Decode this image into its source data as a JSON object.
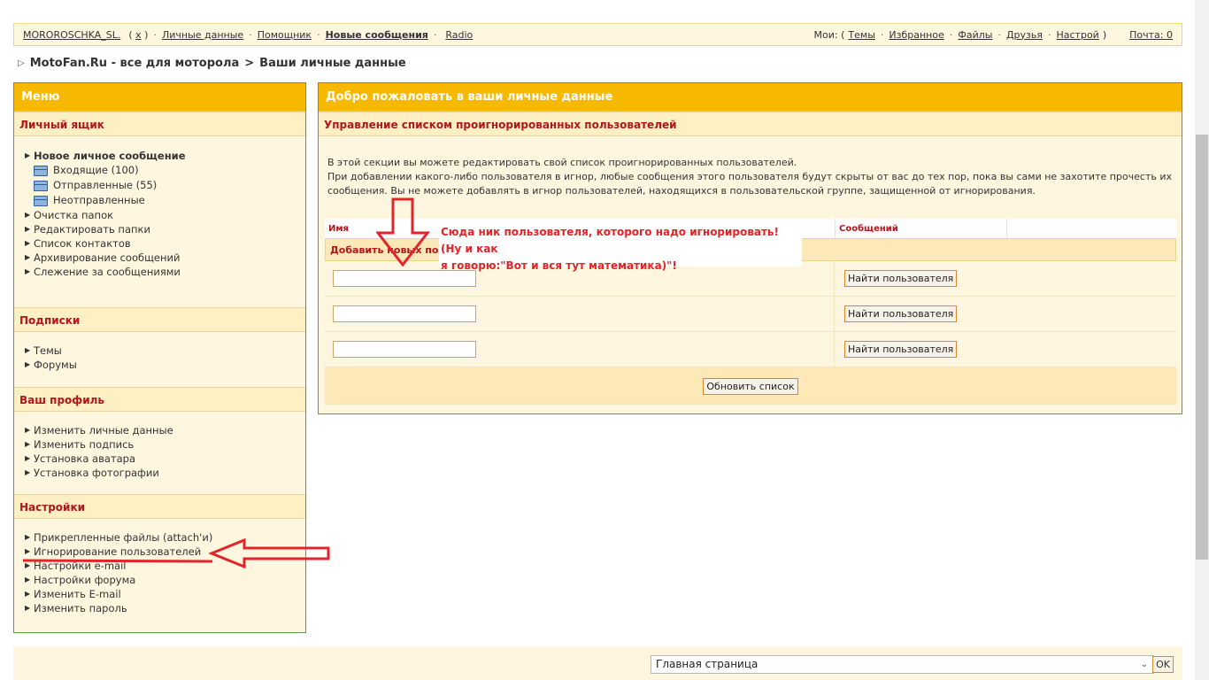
{
  "topbar": {
    "username": "MOROROSCHKA_SL.",
    "logout": "x",
    "personal": "Личные данные",
    "helper": "Помощник",
    "new_messages": "Новые сообщения",
    "radio": "Radio",
    "my_label": "Мои: (",
    "topics": "Темы",
    "favorites": "Избранное",
    "files": "Файлы",
    "friends": "Друзья",
    "settings": "Настрой",
    "mail": "Почта: 0"
  },
  "breadcrumb": {
    "site": "MotoFan.Ru - все для моторола",
    "sep": ">",
    "page": "Ваши личные данные"
  },
  "sidebar": {
    "title": "Меню",
    "mailbox": {
      "heading": "Личный ящик",
      "new_message": "Новое личное сообщение",
      "folders": [
        "Входящие (100)",
        "Отправленные (55)",
        "Неотправленные"
      ],
      "items": [
        "Очистка папок",
        "Редактировать папки",
        "Список контактов",
        "Архивирование сообщений",
        "Слежение за сообщениями"
      ]
    },
    "subscriptions": {
      "heading": "Подписки",
      "items": [
        "Темы",
        "Форумы"
      ]
    },
    "profile": {
      "heading": "Ваш профиль",
      "items": [
        "Изменить личные данные",
        "Изменить подпись",
        "Установка аватара",
        "Установка фотографии"
      ]
    },
    "settings": {
      "heading": "Настройки",
      "items": [
        "Прикрепленные файлы (attach'и)",
        "Игнорирование пользователей",
        "Настройки e-mail",
        "Настройки форума",
        "Изменить E-mail",
        "Изменить пароль"
      ]
    }
  },
  "main": {
    "title": "Добро пожаловать в ваши личные данные",
    "section": "Управление списком проигнорированных пользователей",
    "intro_line1": "В этой секции вы можете редактировать свой список проигнорированных пользователей.",
    "intro_line2": "При добавлении какого-либо пользователя в игнор, любые сообщения этого пользователя будут скрыты от вас до тех пор, пока вы сами не захотите прочесть их сообщения. Вы не можете добавлять в игнор пользователей, находящихся в пользовательской группе, защищенной от игнорирования.",
    "col_name": "Имя",
    "col_messages": "Сообщений",
    "add_row": "Добавить новых по",
    "find_button": "Найти пользователя",
    "update_button": "Обновить список"
  },
  "annotation": {
    "line1": "Сюда ник пользователя, которого надо игнорировать! (Ну и как",
    "line2": "я говорю:\"Вот и вся тут математика)\"!",
    "color": "#e0252b"
  },
  "bottom": {
    "jump_select": "Главная страница",
    "ok": "OK"
  },
  "colors": {
    "header": "#f7b900",
    "panel": "#fff6df",
    "section_text": "#b2161c",
    "border": "#5d9a4a"
  }
}
